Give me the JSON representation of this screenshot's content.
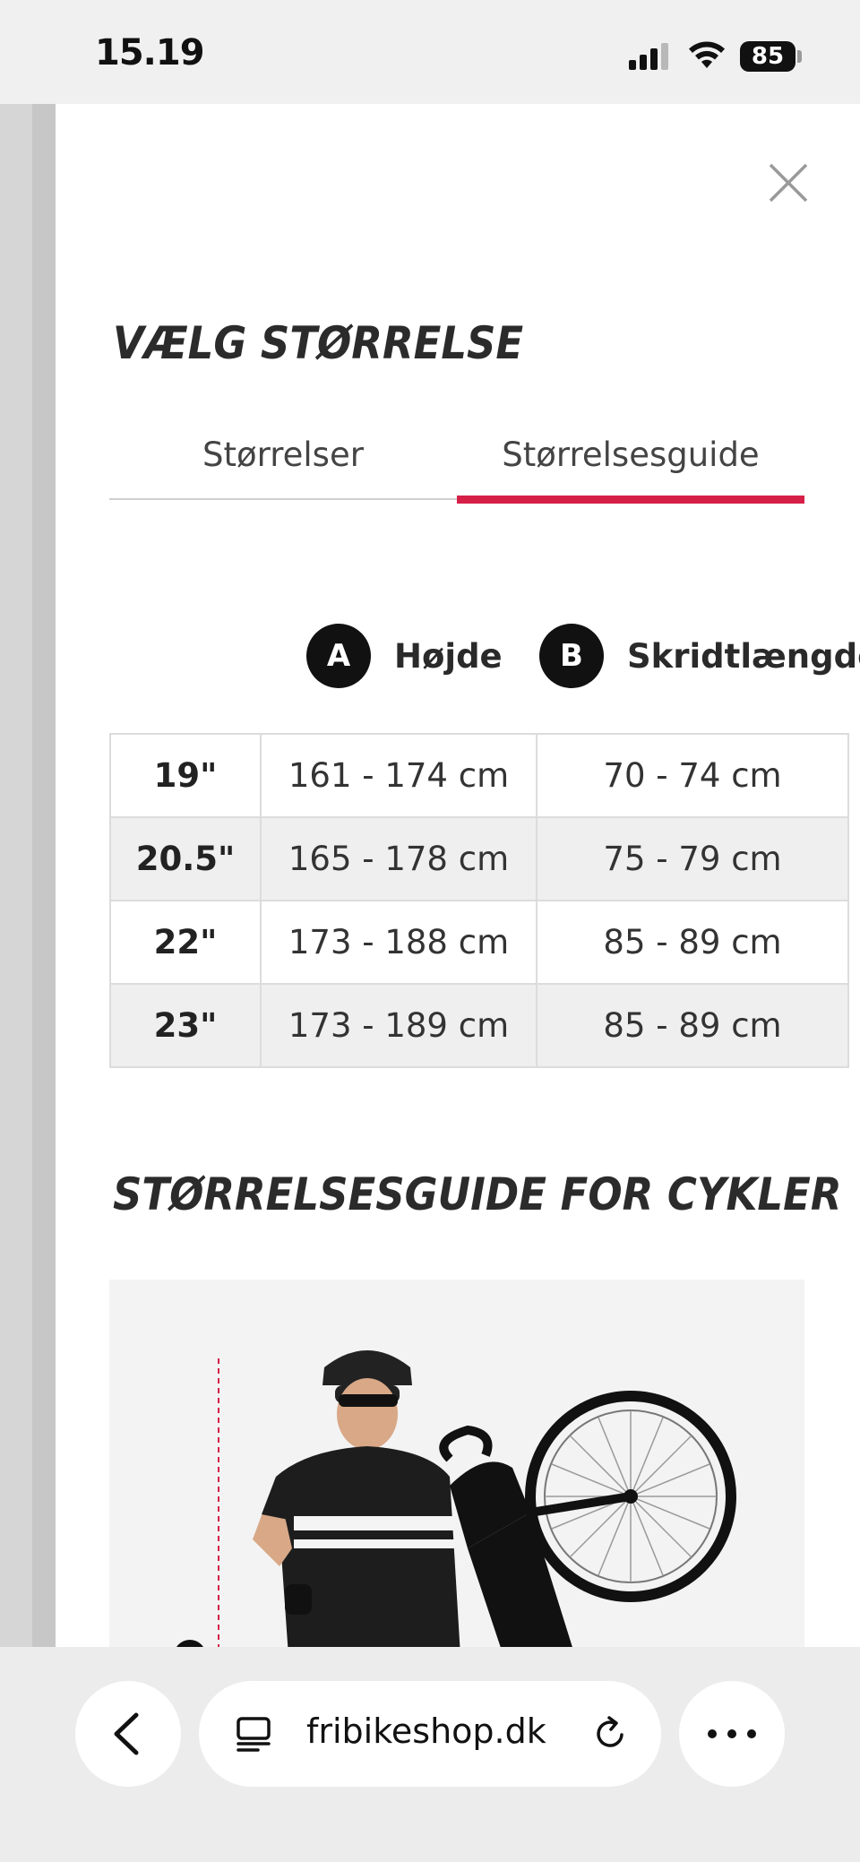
{
  "status": {
    "time": "15.19",
    "battery": "85"
  },
  "modal": {
    "title": "VÆLG STØRRELSE",
    "tabs": [
      {
        "label": "Størrelser",
        "selected": false
      },
      {
        "label": "Størrelsesguide",
        "selected": true
      }
    ],
    "accent_color": "#d51f47"
  },
  "legend": [
    {
      "badge": "A",
      "label": "Højde"
    },
    {
      "badge": "B",
      "label": "Skridtlængde"
    }
  ],
  "size_table": {
    "rows": [
      {
        "size": "19\"",
        "height": "161 - 174 cm",
        "inseam": "70 - 74 cm"
      },
      {
        "size": "20.5\"",
        "height": "165 - 178 cm",
        "inseam": "75 - 79 cm"
      },
      {
        "size": "22\"",
        "height": "173 - 188 cm",
        "inseam": "85 - 89 cm"
      },
      {
        "size": "23\"",
        "height": "173 - 189 cm",
        "inseam": "85 - 89 cm"
      }
    ]
  },
  "guide": {
    "heading": "STØRRELSESGUIDE FOR CYKLER",
    "image_description_icon": "cyclist-with-bike-photo"
  },
  "browser": {
    "url": "fribikeshop.dk"
  }
}
